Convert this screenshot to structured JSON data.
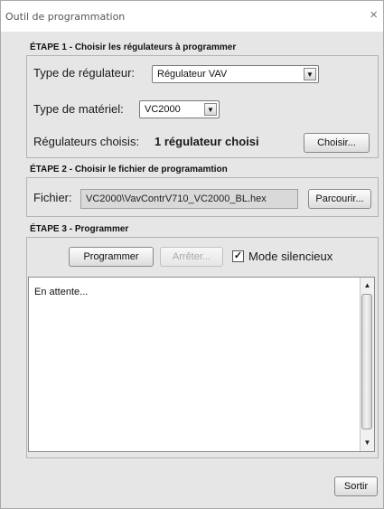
{
  "window": {
    "title": "Outil de programmation",
    "close_glyph": "×"
  },
  "step1": {
    "title": "ÉTAPE 1 - Choisir les régulateurs à programmer",
    "regulator_type_label": "Type de régulateur:",
    "regulator_type_value": "Régulateur VAV",
    "hardware_type_label": "Type de matériel:",
    "hardware_type_value": "VC2000",
    "chosen_label": "Régulateurs choisis:",
    "chosen_value": "1 régulateur choisi",
    "choose_button": "Choisir..."
  },
  "step2": {
    "title": "ÉTAPE 2 - Choisir le fichier de programamtion",
    "file_label": "Fichier:",
    "file_value": "VC2000\\VavContrV710_VC2000_BL.hex",
    "browse_button": "Parcourir..."
  },
  "step3": {
    "title": "ÉTAPE 3 - Programmer",
    "program_button": "Programmer",
    "stop_button": "Arrêter...",
    "silent_mode_label": "Mode silencieux",
    "silent_mode_checked": true,
    "check_glyph": "✓",
    "log_text": "En attente..."
  },
  "icons": {
    "combo_arrow": "▼",
    "scroll_up": "▲",
    "scroll_down": "▼"
  },
  "footer": {
    "exit_button": "Sortir"
  }
}
